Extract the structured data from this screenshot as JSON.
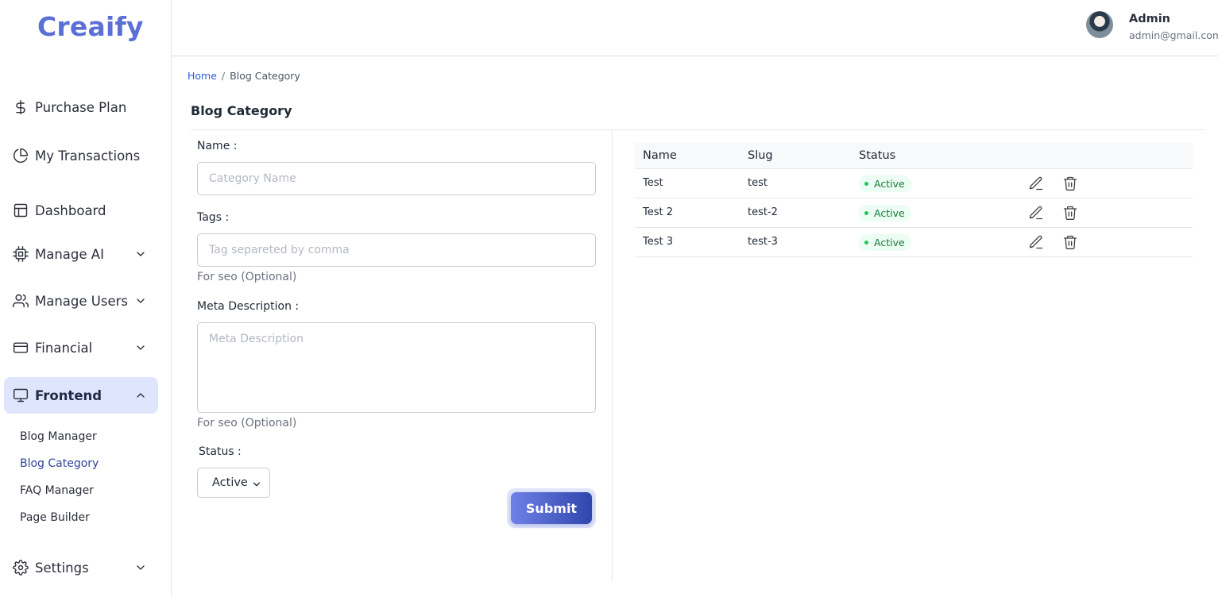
{
  "brand": {
    "logo": "Creaify"
  },
  "sidebar": {
    "items": [
      {
        "label": "Purchase Plan",
        "icon": "dollar-icon"
      },
      {
        "label": "My Transactions",
        "icon": "pie-chart-icon"
      },
      {
        "label": "Dashboard",
        "icon": "layout-icon"
      },
      {
        "label": "Manage AI",
        "icon": "cpu-icon"
      },
      {
        "label": "Manage Users",
        "icon": "users-icon"
      },
      {
        "label": "Financial",
        "icon": "credit-card-icon"
      },
      {
        "label": "Frontend",
        "icon": "monitor-icon"
      },
      {
        "label": "Settings",
        "icon": "gear-icon"
      }
    ],
    "frontend_sub": [
      "Blog Manager",
      "Blog Category",
      "FAQ Manager",
      "Page Builder"
    ]
  },
  "header": {
    "user_name": "Admin",
    "user_email": "admin@gmail.com"
  },
  "breadcrumb": {
    "home": "Home",
    "sep": "/",
    "current": "Blog Category"
  },
  "page_title": "Blog Category",
  "form": {
    "name_label": "Name :",
    "name_placeholder": "Category Name",
    "tags_label": "Tags :",
    "tags_placeholder": "Tag separeted by comma",
    "tags_help": "For seo (Optional)",
    "meta_label": "Meta Description :",
    "meta_placeholder": "Meta Description",
    "meta_help": "For seo (Optional)",
    "status_label": "Status :",
    "status_value": "Active",
    "submit_label": "Submit"
  },
  "table": {
    "headers": [
      "Name",
      "Slug",
      "Status"
    ],
    "rows": [
      {
        "name": "Test",
        "slug": "test",
        "status": "Active"
      },
      {
        "name": "Test 2",
        "slug": "test-2",
        "status": "Active"
      },
      {
        "name": "Test 3",
        "slug": "test-3",
        "status": "Active"
      }
    ]
  },
  "colors": {
    "brand": "#5b6fd6",
    "active_nav_bg": "#dfe5fd",
    "status_active_bg": "#ecfdf3",
    "status_active_text": "#137a3a",
    "submit_gradient_start": "#6f81e6",
    "submit_gradient_end": "#2f46ad"
  }
}
